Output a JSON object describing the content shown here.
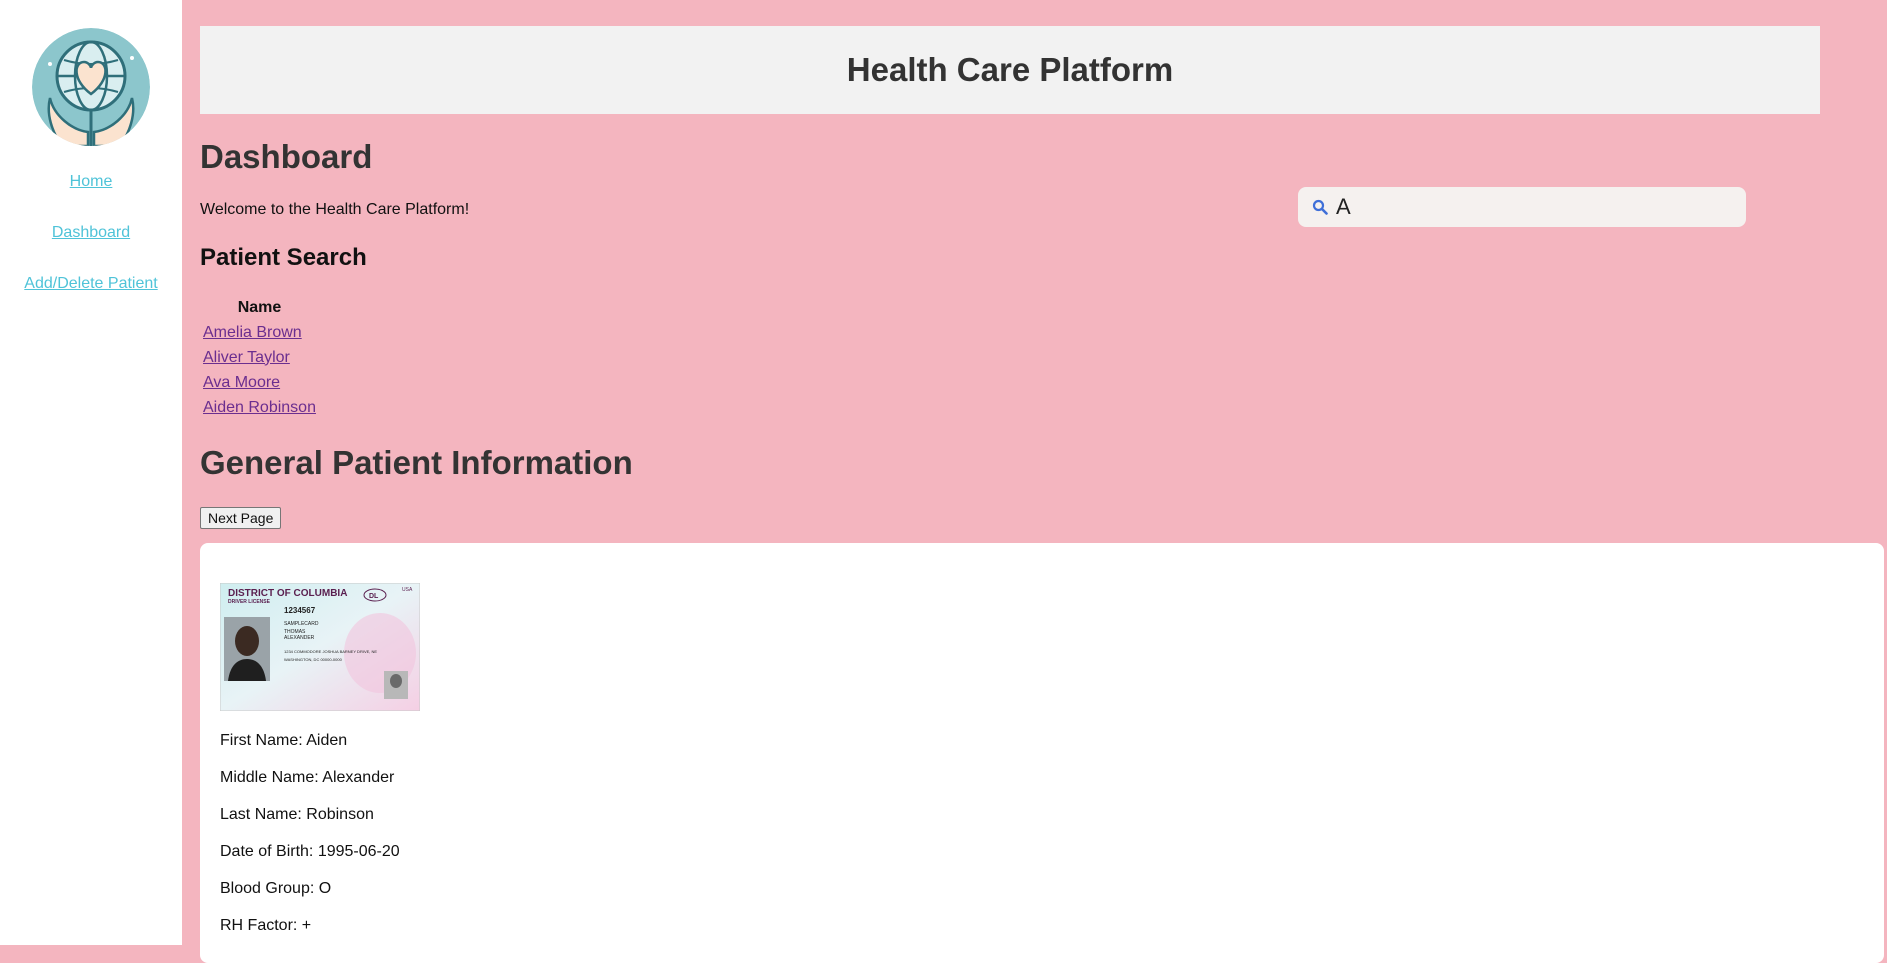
{
  "sidebar": {
    "nav": [
      {
        "label": "Home"
      },
      {
        "label": "Dashboard"
      },
      {
        "label": "Add/Delete Patient"
      }
    ]
  },
  "header": {
    "title": "Health Care Platform"
  },
  "dashboard": {
    "title": "Dashboard",
    "welcome": "Welcome to the Health Care Platform!"
  },
  "search": {
    "value": "A",
    "icon": "search-icon"
  },
  "patient_search": {
    "title": "Patient Search",
    "column_header": "Name",
    "results": [
      "Amelia Brown",
      "Aliver Taylor",
      "Ava Moore",
      "Aiden Robinson"
    ]
  },
  "general_info": {
    "title": "General Patient Information",
    "next_label": "Next Page",
    "id_card": {
      "state": "DISTRICT OF COLUMBIA",
      "type": "DRIVER LICENSE",
      "badge": "DL",
      "country": "USA",
      "number": "1234567",
      "surname": "SAMPLECARD",
      "given": "THOMAS",
      "middle": "ALEXANDER",
      "address1": "1234 COMMODORE JOSHUA BARNEY DRIVE, NE",
      "address2": "WASHINGTON, DC 00000-0000"
    },
    "fields": [
      {
        "label": "First Name:",
        "value": "Aiden"
      },
      {
        "label": "Middle Name:",
        "value": "Alexander"
      },
      {
        "label": "Last Name:",
        "value": "Robinson"
      },
      {
        "label": "Date of Birth:",
        "value": "1995-06-20"
      },
      {
        "label": "Blood Group:",
        "value": "O"
      },
      {
        "label": "RH Factor:",
        "value": "+"
      }
    ]
  }
}
